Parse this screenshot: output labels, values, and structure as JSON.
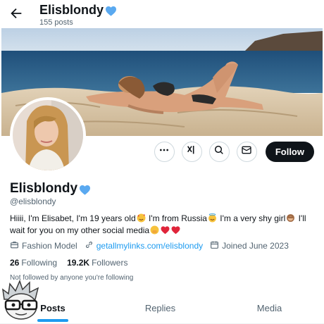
{
  "header": {
    "title": "Elisblondy",
    "post_count": "155 posts",
    "back_icon": "arrow-left-icon"
  },
  "profile": {
    "name": "Elisblondy",
    "handle": "@elisblondy",
    "bio": [
      {
        "text": "Hiiii, I'm Elisabet, I'm 19 years old"
      },
      {
        "emoji": "smiling-face-with-hearts"
      },
      {
        "text": " I'm from Russia"
      },
      {
        "emoji": "smiling-face-with-halo"
      },
      {
        "text": " I'm a very shy girl"
      },
      {
        "emoji": "see-no-evil-monkey"
      },
      {
        "text": " I'll wait for you on my other social media"
      },
      {
        "emoji": "hand-over-mouth-face"
      },
      {
        "emoji": "red-heart"
      },
      {
        "emoji": "red-heart"
      }
    ],
    "category": "Fashion Model",
    "link": "getallmylinks.com/elisblondy",
    "joined": "Joined June 2023",
    "following_count": "26",
    "following_label": "Following",
    "followers_count": "19.2K",
    "followers_label": "Followers",
    "not_followed": "Not followed by anyone you're following"
  },
  "actions": {
    "more_icon": "more-dots-icon",
    "grok_icon": "grok-icon",
    "search_icon": "search-icon",
    "message_icon": "envelope-icon",
    "follow_label": "Follow"
  },
  "tabs": [
    {
      "label": "Posts",
      "active": true
    },
    {
      "label": "Replies",
      "active": false
    },
    {
      "label": "Media",
      "active": false
    }
  ],
  "colors": {
    "accent": "#1d9bf0",
    "verified_heart": "#5aa9f0",
    "follow_button": "#0f1419",
    "muted_text": "#536471"
  }
}
